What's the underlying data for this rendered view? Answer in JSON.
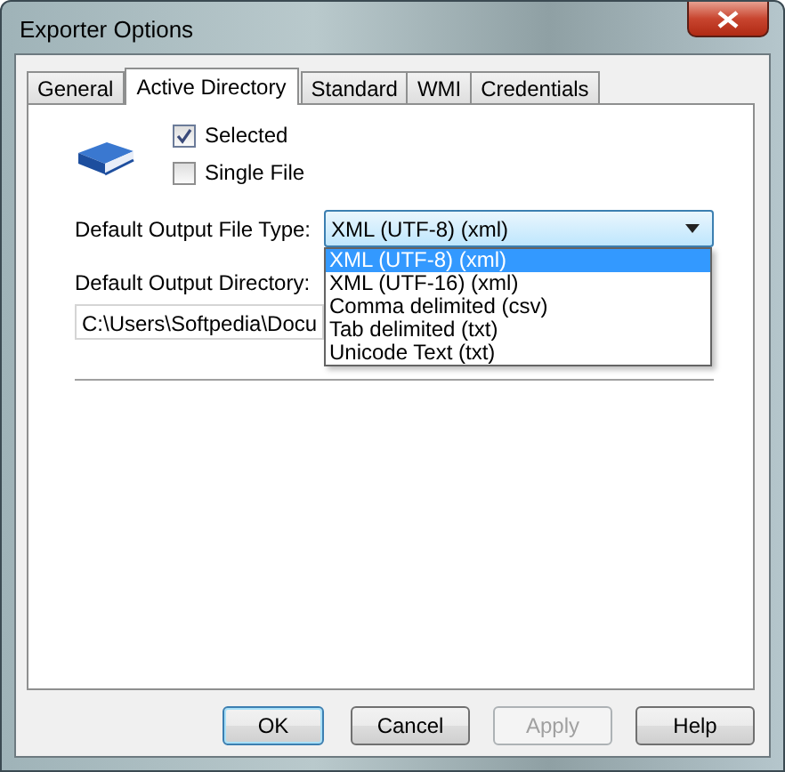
{
  "window": {
    "title": "Exporter Options"
  },
  "tabs": [
    {
      "label": "General",
      "selected": false
    },
    {
      "label": "Active Directory",
      "selected": true
    },
    {
      "label": "Standard",
      "selected": false
    },
    {
      "label": "WMI",
      "selected": false
    },
    {
      "label": "Credentials",
      "selected": false
    }
  ],
  "checkboxes": [
    {
      "label": "Selected",
      "checked": true
    },
    {
      "label": "Single File",
      "checked": false
    }
  ],
  "file_type": {
    "label": "Default Output File Type:",
    "value": "XML (UTF-8) (xml)",
    "expanded": true,
    "options": [
      {
        "label": "XML (UTF-8) (xml)",
        "selected": true
      },
      {
        "label": "XML (UTF-16) (xml)",
        "selected": false
      },
      {
        "label": "Comma delimited (csv)",
        "selected": false
      },
      {
        "label": "Tab delimited (txt)",
        "selected": false
      },
      {
        "label": "Unicode Text (txt)",
        "selected": false
      }
    ]
  },
  "output_directory": {
    "label": "Default Output Directory:",
    "value": "C:\\Users\\Softpedia\\Docu"
  },
  "buttons": [
    {
      "label": "OK",
      "default": true,
      "disabled": false
    },
    {
      "label": "Cancel",
      "default": false,
      "disabled": false
    },
    {
      "label": "Apply",
      "default": false,
      "disabled": true
    },
    {
      "label": "Help",
      "default": false,
      "disabled": false
    }
  ]
}
